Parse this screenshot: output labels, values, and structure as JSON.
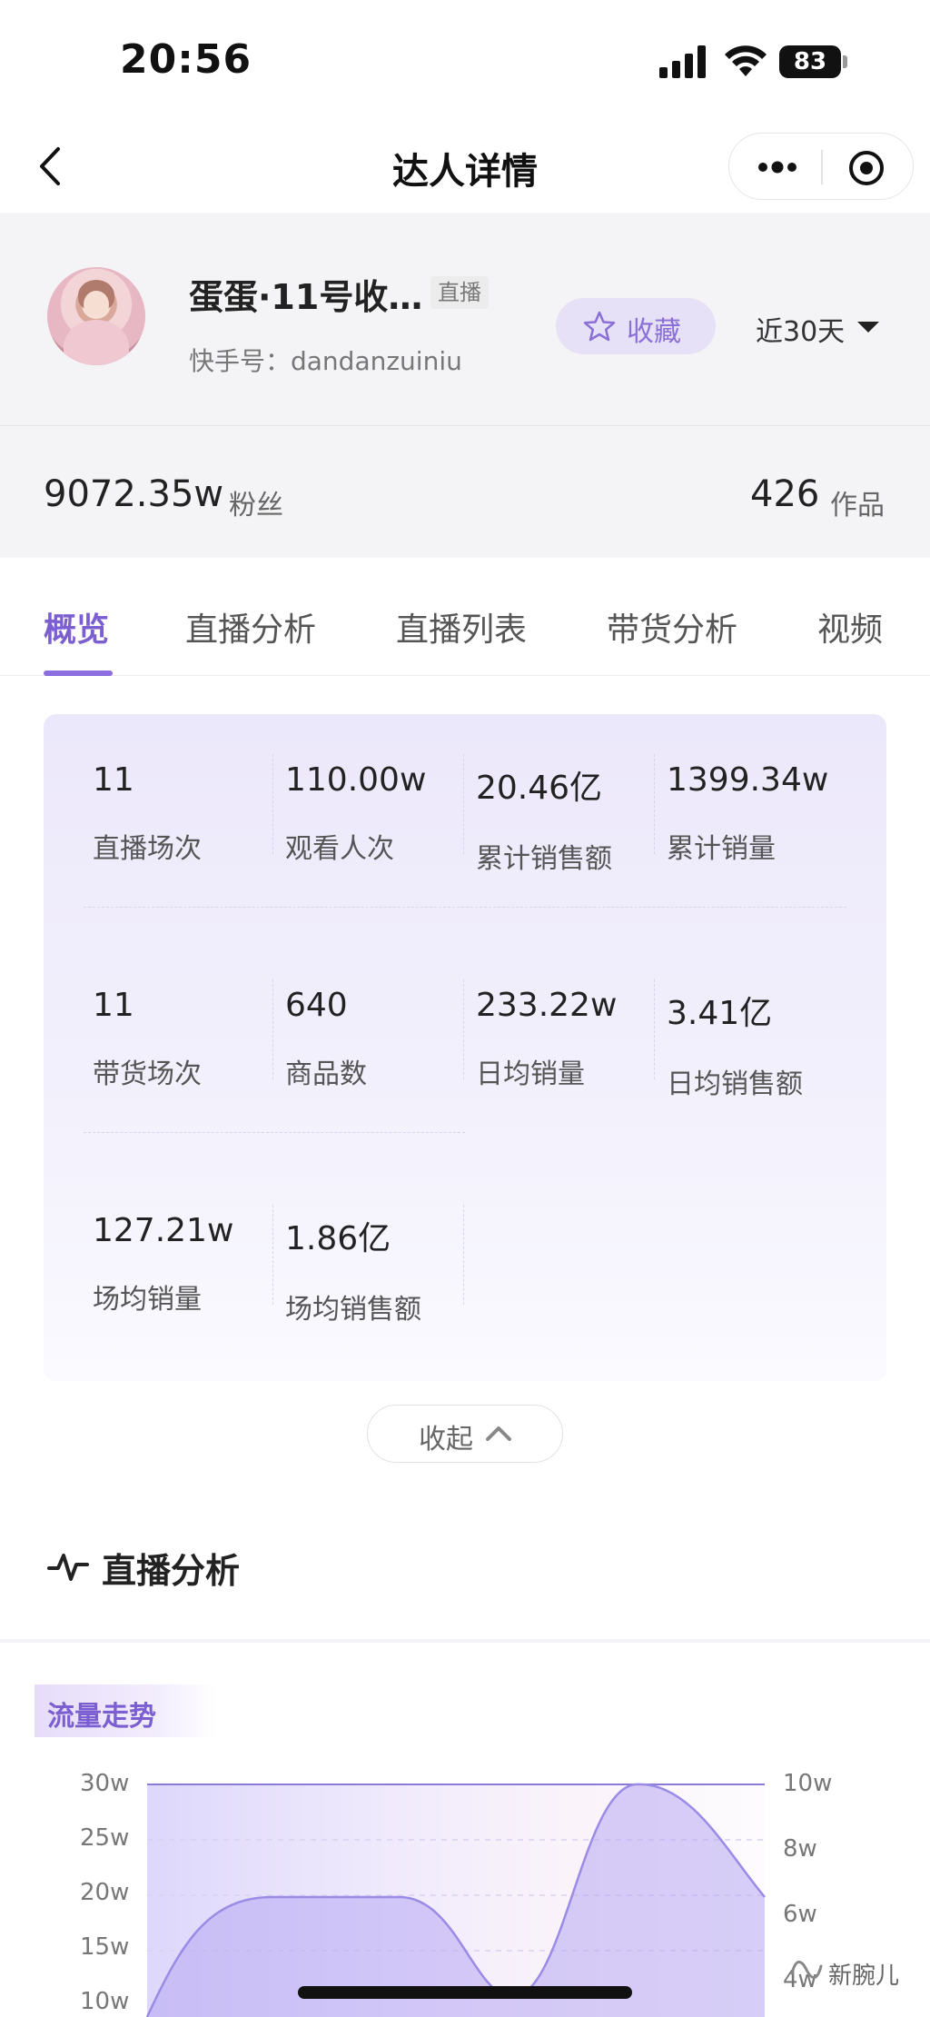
{
  "status_bar": {
    "time": "20:56",
    "battery": "83"
  },
  "nav": {
    "title": "达人详情"
  },
  "profile": {
    "name": "蛋蛋·11号收…",
    "tag": "直播",
    "id": "快手号：dandanzuiniu",
    "favorite_label": "收藏",
    "period": "近30天"
  },
  "stats": {
    "fans_value": "9072.35w",
    "fans_label": "粉丝",
    "works_value": "426",
    "works_label": "作品"
  },
  "tabs": [
    "概览",
    "直播分析",
    "直播列表",
    "带货分析",
    "视频"
  ],
  "overview": [
    {
      "value": "11",
      "label": "直播场次"
    },
    {
      "value": "110.00w",
      "label": "观看人次"
    },
    {
      "value": "20.46亿",
      "label": "累计销售额"
    },
    {
      "value": "1399.34w",
      "label": "累计销量"
    },
    {
      "value": "11",
      "label": "带货场次"
    },
    {
      "value": "640",
      "label": "商品数"
    },
    {
      "value": "233.22w",
      "label": "日均销量"
    },
    {
      "value": "3.41亿",
      "label": "日均销售额"
    },
    {
      "value": "127.21w",
      "label": "场均销量"
    },
    {
      "value": "1.86亿",
      "label": "场均销售额"
    }
  ],
  "collapse_label": "收起",
  "section_title": "直播分析",
  "chart": {
    "tag": "流量走势",
    "left_ticks": [
      "30w",
      "25w",
      "20w",
      "15w",
      "10w"
    ],
    "right_ticks": [
      "10w",
      "8w",
      "6w",
      "4w"
    ]
  },
  "watermark": "新腕儿",
  "colors": {
    "accent": "#7b5fd0",
    "accent_light": "#e7e1f8"
  }
}
